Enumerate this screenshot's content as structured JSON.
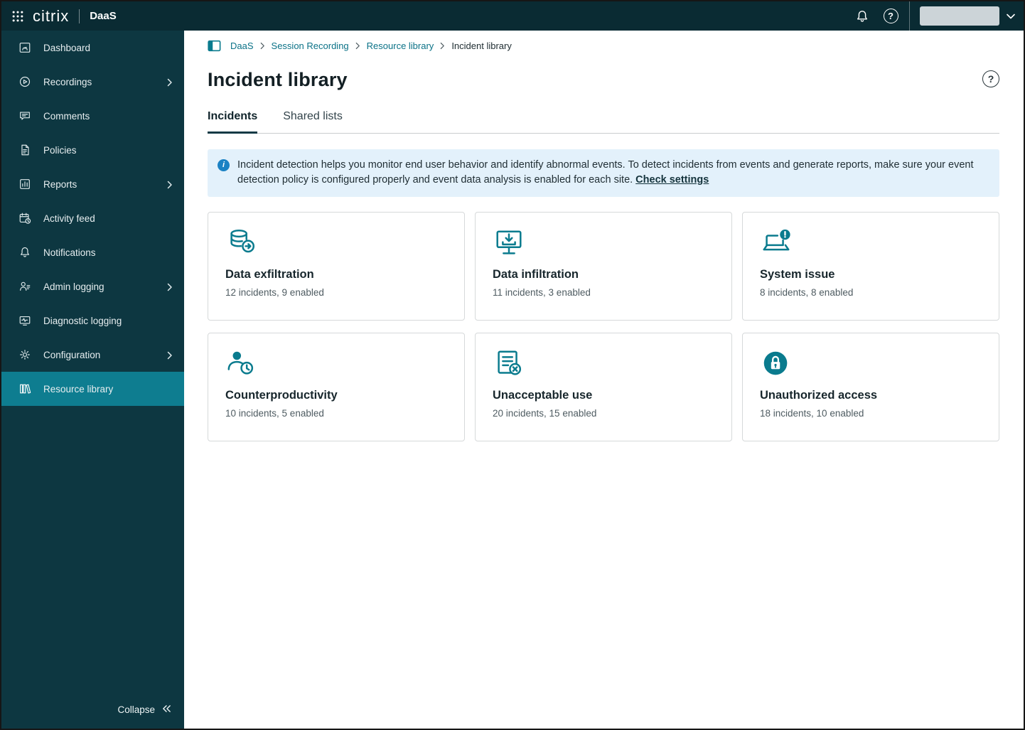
{
  "header": {
    "brand": "citrix",
    "product": "DaaS",
    "icons": [
      "waffle-menu-icon",
      "bell-icon",
      "help-icon",
      "user-menu",
      "chevron-down-icon"
    ]
  },
  "sidebar": {
    "items": [
      {
        "label": "Dashboard",
        "icon": "dashboard-icon",
        "expandable": false,
        "active": false
      },
      {
        "label": "Recordings",
        "icon": "recordings-icon",
        "expandable": true,
        "active": false
      },
      {
        "label": "Comments",
        "icon": "comments-icon",
        "expandable": false,
        "active": false
      },
      {
        "label": "Policies",
        "icon": "policies-icon",
        "expandable": false,
        "active": false
      },
      {
        "label": "Reports",
        "icon": "reports-icon",
        "expandable": true,
        "active": false
      },
      {
        "label": "Activity feed",
        "icon": "activity-feed-icon",
        "expandable": false,
        "active": false
      },
      {
        "label": "Notifications",
        "icon": "notifications-icon",
        "expandable": false,
        "active": false
      },
      {
        "label": "Admin logging",
        "icon": "admin-logging-icon",
        "expandable": true,
        "active": false
      },
      {
        "label": "Diagnostic logging",
        "icon": "diagnostic-logging-icon",
        "expandable": false,
        "active": false
      },
      {
        "label": "Configuration",
        "icon": "configuration-icon",
        "expandable": true,
        "active": false
      },
      {
        "label": "Resource library",
        "icon": "resource-library-icon",
        "expandable": false,
        "active": true
      }
    ],
    "collapse_label": "Collapse"
  },
  "breadcrumb": {
    "items": [
      {
        "label": "DaaS",
        "link": true
      },
      {
        "label": "Session Recording",
        "link": true
      },
      {
        "label": "Resource library",
        "link": true
      },
      {
        "label": "Incident library",
        "link": false
      }
    ]
  },
  "page": {
    "title": "Incident library"
  },
  "tabs": [
    {
      "label": "Incidents",
      "active": true
    },
    {
      "label": "Shared lists",
      "active": false
    }
  ],
  "banner": {
    "text": "Incident detection helps you monitor end user behavior and identify abnormal events. To detect incidents from events and generate reports, make sure your event detection policy is configured properly and event data analysis is enabled for each site.",
    "link_label": "Check settings"
  },
  "cards": [
    {
      "title": "Data exfiltration",
      "subtitle": "12 incidents, 9 enabled",
      "icon": "data-exfiltration-icon"
    },
    {
      "title": "Data infiltration",
      "subtitle": "11 incidents, 3 enabled",
      "icon": "data-infiltration-icon"
    },
    {
      "title": "System issue",
      "subtitle": "8 incidents, 8 enabled",
      "icon": "system-issue-icon"
    },
    {
      "title": "Counterproductivity",
      "subtitle": "10 incidents, 5 enabled",
      "icon": "counterproductivity-icon"
    },
    {
      "title": "Unacceptable use",
      "subtitle": "20 incidents, 15 enabled",
      "icon": "unacceptable-use-icon"
    },
    {
      "title": "Unauthorized access",
      "subtitle": "18 incidents, 10 enabled",
      "icon": "unauthorized-access-icon"
    }
  ],
  "colors": {
    "header_bg": "#0a2b33",
    "sidebar_bg": "#0d3741",
    "sidebar_active": "#0e7d90",
    "accent_teal": "#0a7b8e",
    "link_teal": "#0b7287",
    "banner_bg": "#e3f1fb",
    "info_blue": "#1b82c4"
  }
}
